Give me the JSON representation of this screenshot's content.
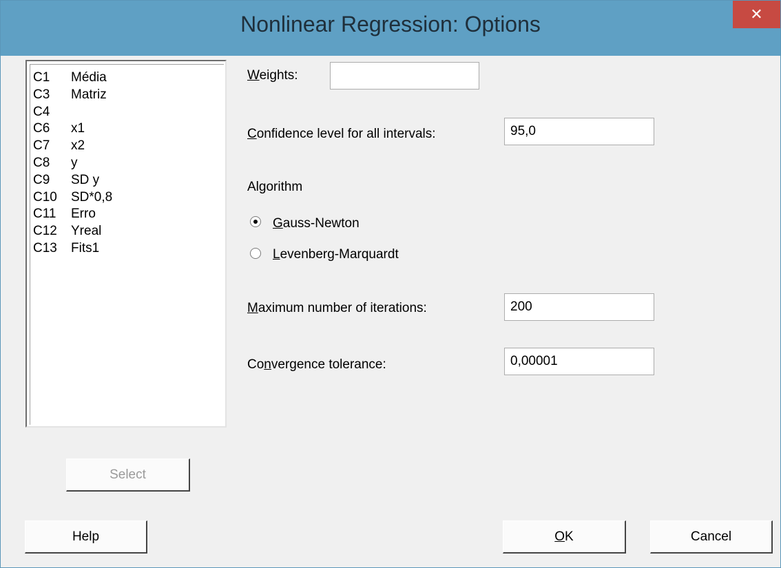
{
  "window": {
    "title": "Nonlinear Regression: Options",
    "close_glyph": "✕"
  },
  "columns": [
    {
      "id": "C1",
      "name": "Média"
    },
    {
      "id": "C3",
      "name": "Matriz"
    },
    {
      "id": "C4",
      "name": ""
    },
    {
      "id": "C6",
      "name": "x1"
    },
    {
      "id": "C7",
      "name": "x2"
    },
    {
      "id": "C8",
      "name": "y"
    },
    {
      "id": "C9",
      "name": "SD y"
    },
    {
      "id": "C10",
      "name": "SD*0,8"
    },
    {
      "id": "C11",
      "name": "Erro"
    },
    {
      "id": "C12",
      "name": "Yreal"
    },
    {
      "id": "C13",
      "name": "Fits1"
    }
  ],
  "weights": {
    "label_u": "W",
    "label_rest": "eights:",
    "value": ""
  },
  "confidence": {
    "label_u": "C",
    "label_rest": "onfidence level for all intervals:",
    "value": "95,0"
  },
  "algorithm": {
    "heading": "Algorithm",
    "options": [
      {
        "u": "G",
        "rest": "auss-Newton",
        "selected": true
      },
      {
        "u": "L",
        "rest": "evenberg-Marquardt",
        "selected": false
      }
    ]
  },
  "max_iter": {
    "label_u": "M",
    "label_rest": "aximum number of iterations:",
    "value": "200"
  },
  "tolerance": {
    "label_pre": "Co",
    "label_u": "n",
    "label_rest": "vergence tolerance:",
    "value": "0,00001"
  },
  "buttons": {
    "select": "Select",
    "help": "Help",
    "ok_u": "O",
    "ok_rest": "K",
    "cancel": "Cancel"
  }
}
